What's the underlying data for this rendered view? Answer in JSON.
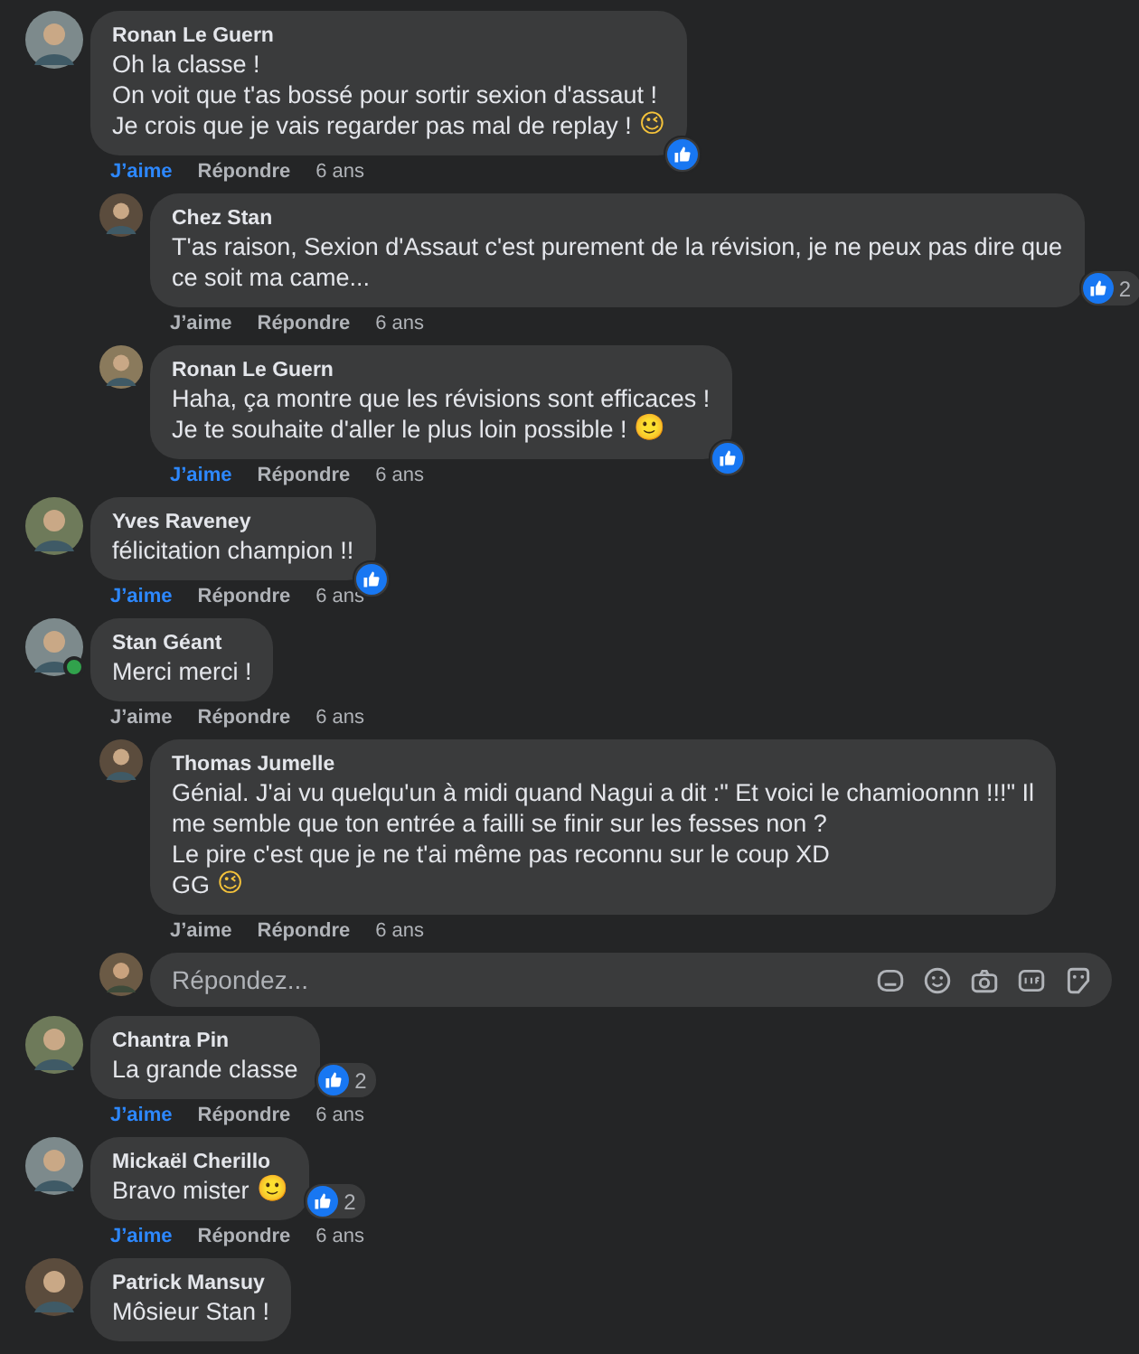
{
  "comments": [
    {
      "author": "Ronan Le Guern",
      "lines": [
        "Oh la classe !",
        "On voit que t'as bossé pour sortir sexion d'assaut !",
        "Je crois que je vais regarder pas mal de replay !"
      ],
      "emoji": "😉",
      "reacted": true,
      "liked": true,
      "online": false,
      "actions": {
        "like": "J’aime",
        "reply": "Répondre",
        "time": "6 ans"
      },
      "replies": [
        {
          "author": "Chez Stan",
          "lines": [
            "T'as raison, Sexion d'Assaut c'est purement de la révision, je ne peux pas dire que",
            "ce soit ma came..."
          ],
          "reacted": true,
          "reaction_count": "2",
          "liked": false,
          "online": false,
          "actions": {
            "like": "J’aime",
            "reply": "Répondre",
            "time": "6 ans"
          }
        },
        {
          "author": "Ronan Le Guern",
          "lines": [
            "Haha, ça montre que les révisions sont efficaces !",
            "Je te souhaite d'aller le plus loin possible !"
          ],
          "emoji": "🙂",
          "reacted": true,
          "liked": true,
          "online": false,
          "actions": {
            "like": "J’aime",
            "reply": "Répondre",
            "time": "6 ans"
          }
        }
      ]
    },
    {
      "author": "Yves Raveney",
      "lines": [
        "félicitation champion !!"
      ],
      "reacted": true,
      "liked": true,
      "online": false,
      "actions": {
        "like": "J’aime",
        "reply": "Répondre",
        "time": "6 ans"
      }
    },
    {
      "author": "Stan Géant",
      "lines": [
        "Merci merci !"
      ],
      "reacted": false,
      "liked": false,
      "online": true,
      "actions": {
        "like": "J’aime",
        "reply": "Répondre",
        "time": "6 ans"
      },
      "replies": [
        {
          "author": "Thomas Jumelle",
          "lines": [
            "Génial. J'ai vu quelqu'un à midi quand Nagui a dit :\" Et voici le chamioonnn !!!\" Il",
            "me semble que ton entrée a failli se finir sur les fesses non ?",
            "Le pire c'est que je ne t'ai même pas reconnu sur le coup XD",
            "GG"
          ],
          "emoji": "😉",
          "reacted": false,
          "liked": false,
          "online": false,
          "actions": {
            "like": "J’aime",
            "reply": "Répondre",
            "time": "6 ans"
          }
        }
      ],
      "reply_box": {
        "placeholder": "Répondez..."
      }
    },
    {
      "author": "Chantra Pin",
      "lines": [
        "La grande classe"
      ],
      "reacted": true,
      "reaction_count": "2",
      "liked": true,
      "online": false,
      "actions": {
        "like": "J’aime",
        "reply": "Répondre",
        "time": "6 ans"
      }
    },
    {
      "author": "Mickaël Cherillo",
      "lines": [
        "Bravo mister"
      ],
      "emoji": "🙂",
      "reacted": true,
      "reaction_count": "2",
      "liked": true,
      "online": false,
      "actions": {
        "like": "J’aime",
        "reply": "Répondre",
        "time": "6 ans"
      }
    },
    {
      "author": "Patrick Mansuy",
      "lines": [
        "Môsieur Stan !"
      ],
      "reacted": false,
      "online": false
    }
  ]
}
